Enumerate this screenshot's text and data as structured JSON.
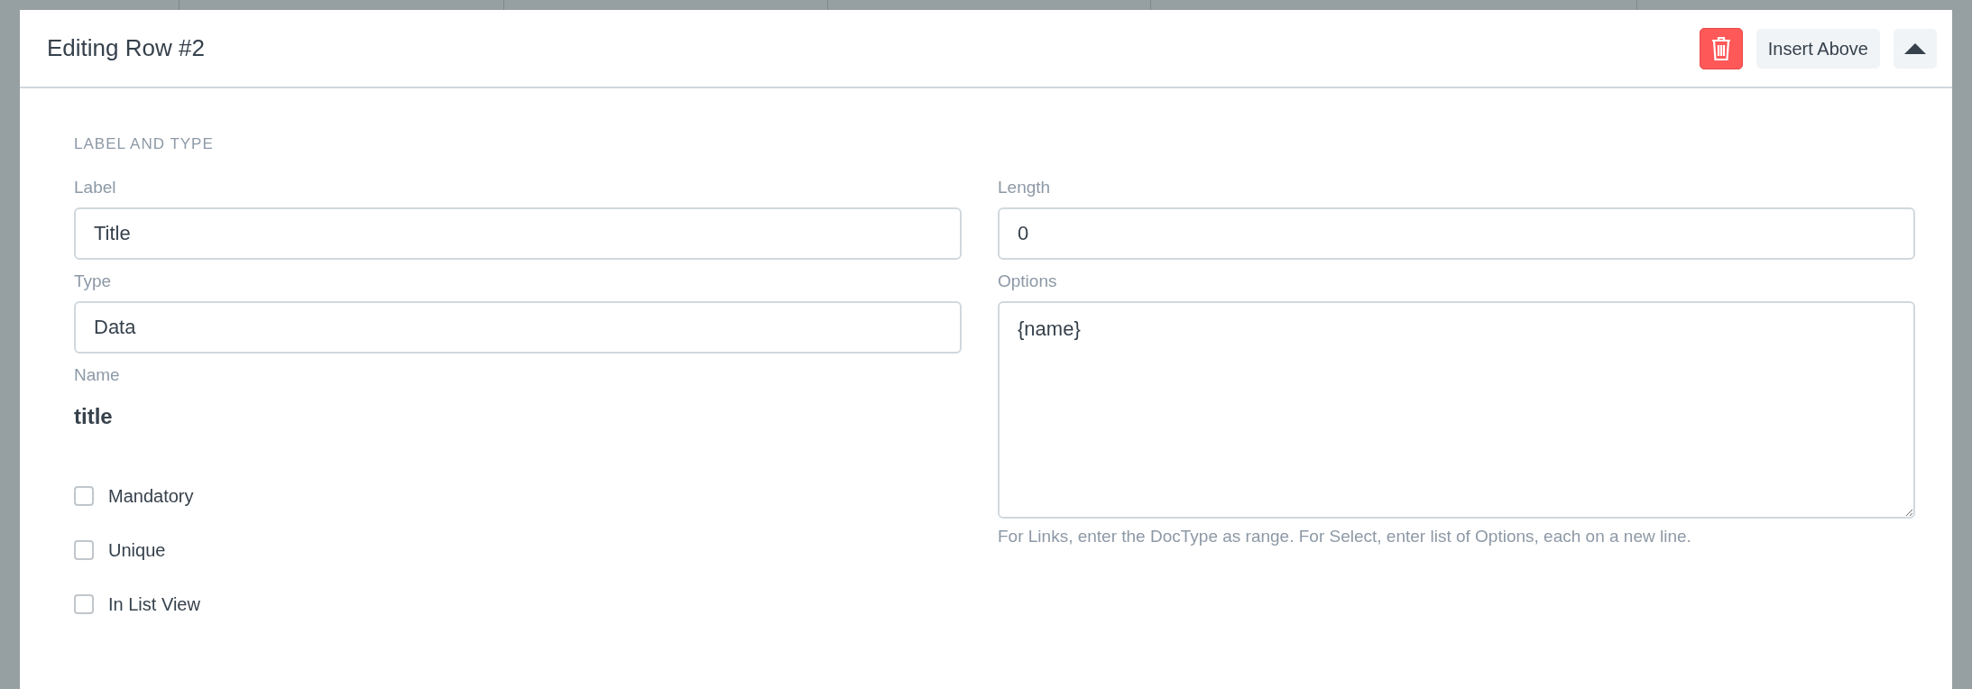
{
  "header": {
    "title": "Editing Row #2",
    "insert_button": "Insert Above"
  },
  "section": {
    "heading": "LABEL AND TYPE"
  },
  "left_fields": [
    {
      "label": "Label",
      "value": "Title"
    },
    {
      "label": "Type",
      "value": "Data"
    }
  ],
  "name": {
    "label": "Name",
    "value": "title"
  },
  "checkboxes": [
    {
      "label": "Mandatory",
      "checked": false
    },
    {
      "label": "Unique",
      "checked": false
    },
    {
      "label": "In List View",
      "checked": false
    }
  ],
  "length": {
    "label": "Length",
    "value": "0"
  },
  "options": {
    "label": "Options",
    "value": "{name}",
    "help": "For Links, enter the DocType as range. For Select, enter list of Options, each on a new line."
  }
}
